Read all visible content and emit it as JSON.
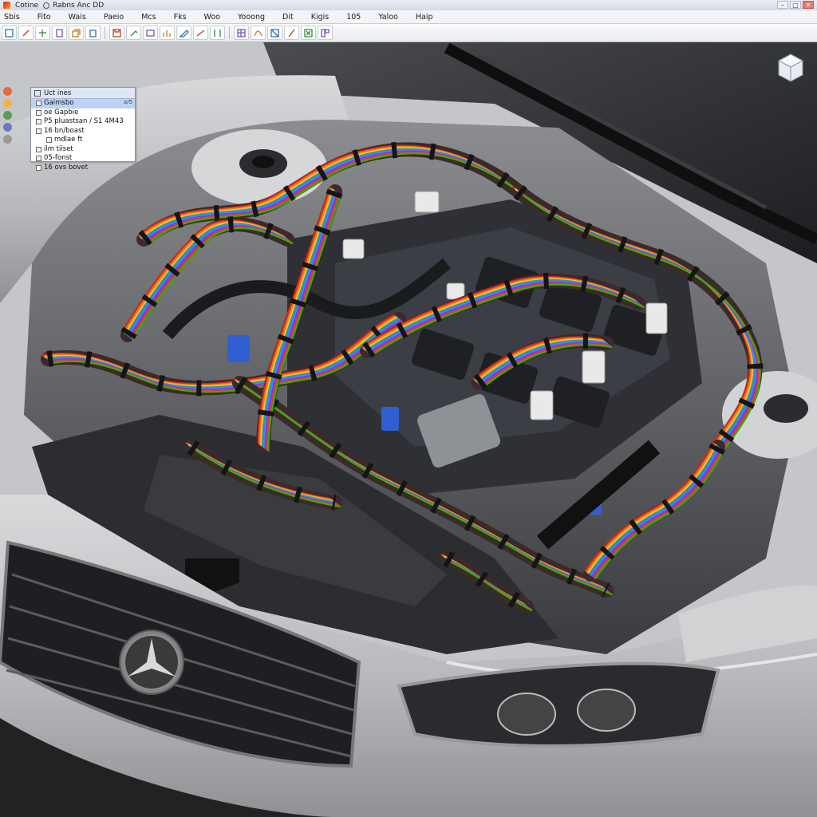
{
  "window": {
    "title_prefix": "Cotine",
    "title_main": "Rabns Anc DD"
  },
  "menu": [
    "Sbis",
    "Fito",
    "Wais",
    "Paeio",
    "Mcs",
    "Fks",
    "Woo",
    "Yooong",
    "Dit",
    "Kigis",
    "105",
    "Yaloo",
    "Haip"
  ],
  "toolbar": {
    "buttons": [
      "open-icon",
      "magnet-icon",
      "link-icon",
      "page-icon",
      "copy-icon",
      "paste-icon",
      "save-icon",
      "clip-icon",
      "window-icon",
      "chart-icon",
      "edit-icon",
      "measure-icon",
      "bracket-icon",
      "grid-icon",
      "draw-icon",
      "shape-icon",
      "pen-icon",
      "close-box-icon",
      "layout-icon"
    ]
  },
  "tree": {
    "header": "Uct ines",
    "extra": "a/5",
    "items": [
      {
        "label": "Gaimsbo",
        "selected": true,
        "indent": 1
      },
      {
        "label": "oe Gapbie",
        "selected": false,
        "indent": 1
      },
      {
        "label": "P5 pluastsan / S1 4M43",
        "selected": false,
        "indent": 1
      },
      {
        "label": "16 bn/boast",
        "selected": false,
        "indent": 1
      },
      {
        "label": "mdlae ft",
        "selected": false,
        "indent": 2
      },
      {
        "label": "ilm tiiset",
        "selected": false,
        "indent": 1
      },
      {
        "label": "05-fonst",
        "selected": false,
        "indent": 1
      },
      {
        "label": "16 ovs bovet",
        "selected": false,
        "indent": 1
      }
    ]
  },
  "colors": {
    "body_paint": "#b9bbbe",
    "plastic": "#2a2b2e",
    "harness_colors": [
      "#d62828",
      "#f77f00",
      "#fcbf49",
      "#2a9d8f",
      "#3a86ff",
      "#8338ec",
      "#e5383b",
      "#38b000"
    ]
  }
}
